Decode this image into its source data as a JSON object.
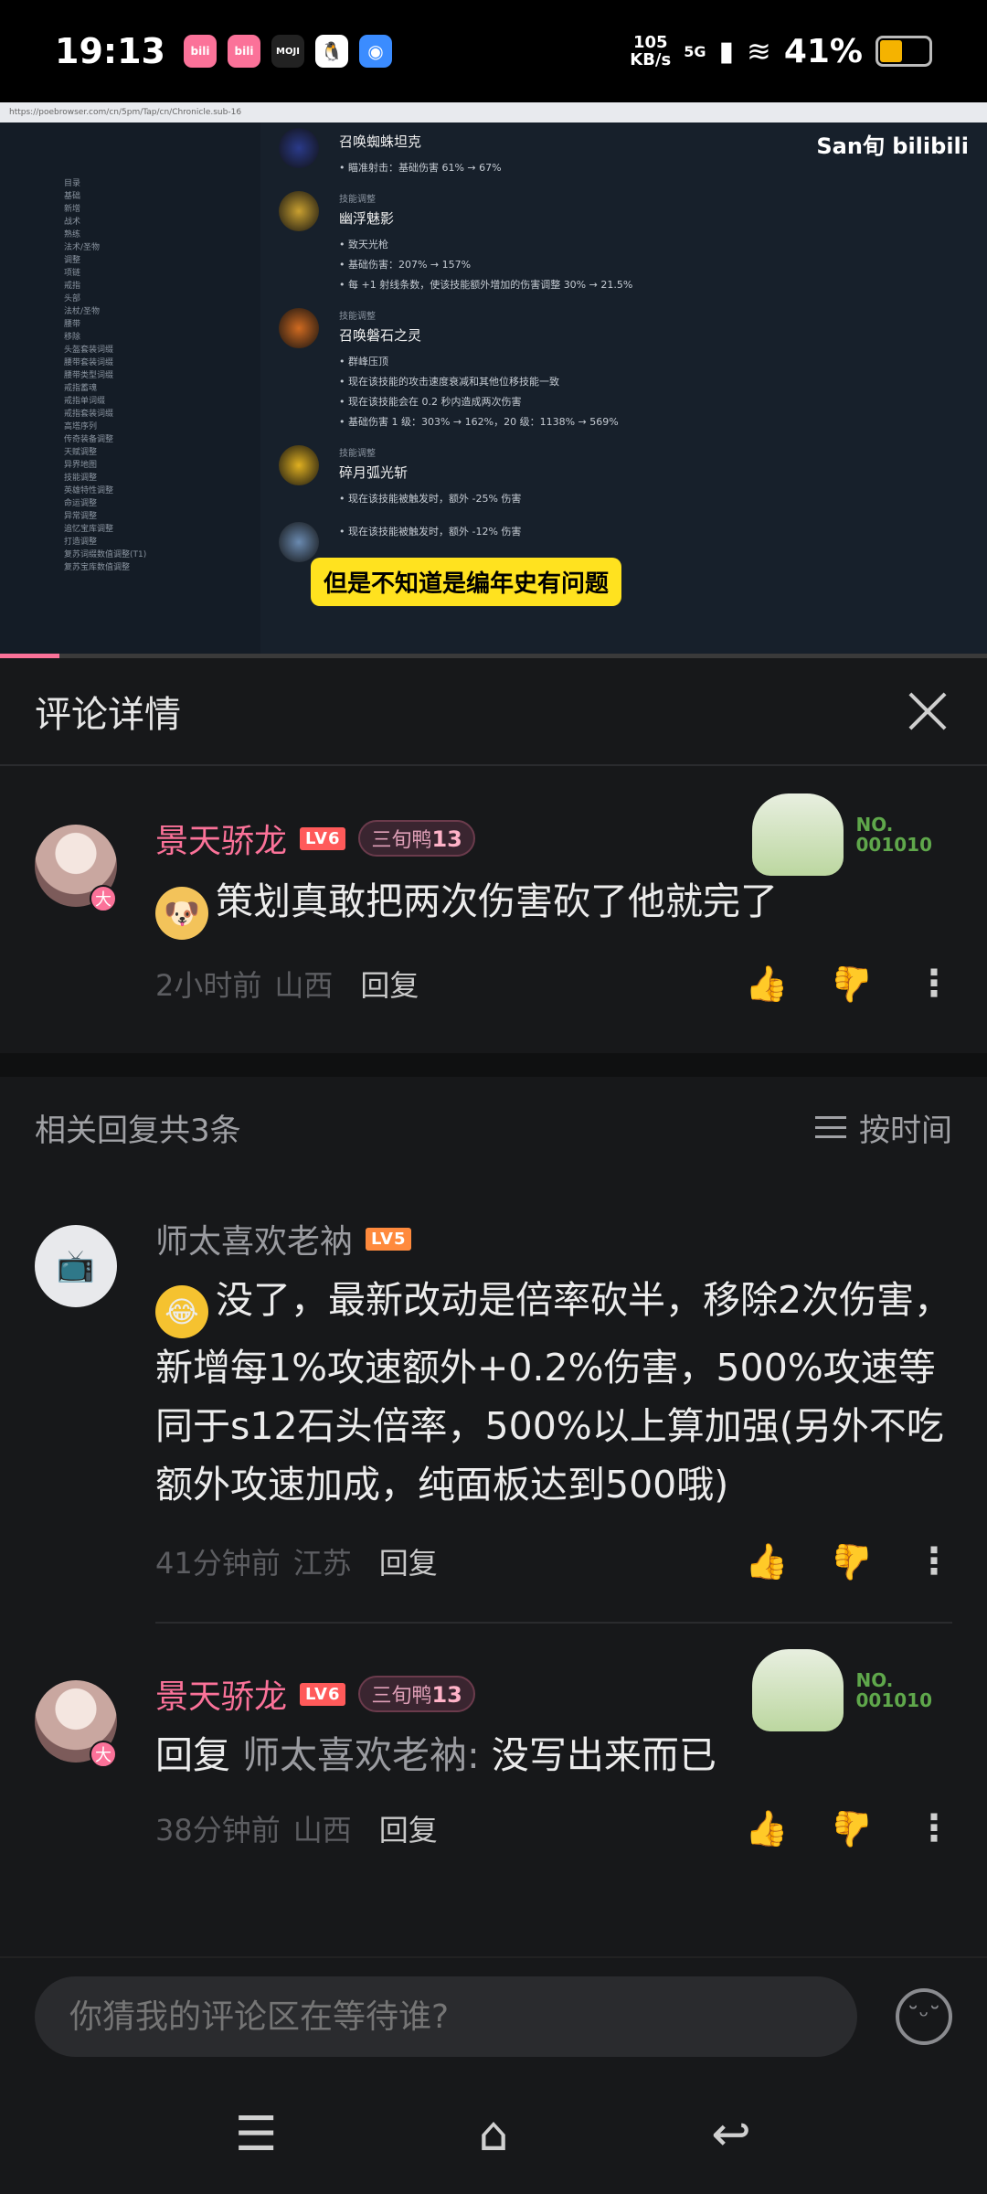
{
  "status_bar": {
    "time": "19:13",
    "net_speed": "105",
    "net_unit": "KB/s",
    "network": "5G",
    "battery": "41%",
    "apps": [
      "bilibili",
      "bilibili",
      "MOJI",
      "QQ",
      "browser"
    ]
  },
  "video": {
    "logo": "San旬 bilibili",
    "caption": "但是不知道是编年史有问题",
    "url": "https://poebrowser.com/cn/5pm/Tap/cn/Chronicle.sub-16",
    "sidebar": [
      "目录",
      "基础",
      "新增",
      "战术",
      "熟练",
      "法术/圣物",
      "调整",
      "项链",
      "戒指",
      "头部",
      "法杖/圣物",
      "腰带",
      "移除",
      "头盔套装词缀",
      "腰带套装词缀",
      "腰带类型词缀",
      "戒指蓄魂",
      "戒指单词缀",
      "戒指套装词缀",
      "高塔序列",
      "传奇装备调整",
      "天赋调整",
      "异界地图",
      "技能调整",
      "英雄特性调整",
      "命运调整",
      "异常调整",
      "追忆宝库调整",
      "打造调整",
      "复苏词缀数值调整(T1)",
      "复苏宝库数值调整"
    ],
    "entries": [
      {
        "tag": "",
        "name": "召唤蜘蛛坦克",
        "lines": [
          "瞄准射击：基础伤害 61% → 67%"
        ]
      },
      {
        "tag": "技能调整",
        "name": "幽浮魅影",
        "lines": [
          "致天光枪",
          "基础伤害：207% → 157%",
          "每 +1 射线条数，使该技能额外增加的伤害调整 30% → 21.5%"
        ]
      },
      {
        "tag": "技能调整",
        "name": "召唤磐石之灵",
        "lines": [
          "群峰压顶",
          "现在该技能的攻击速度衰减和其他位移技能一致",
          "现在该技能会在 0.2 秒内造成两次伤害",
          "基础伤害 1 级：303% → 162%，20 级：1138% → 569%"
        ]
      },
      {
        "tag": "技能调整",
        "name": "碎月弧光斩",
        "lines": [
          "现在该技能被触发时，额外 -25% 伤害"
        ]
      },
      {
        "tag": "",
        "name": "",
        "lines": [
          "现在该技能被触发时，额外 -12% 伤害"
        ]
      }
    ],
    "progress": 0.06
  },
  "panel": {
    "title": "评论详情"
  },
  "main_comment": {
    "username": "景天骄龙",
    "level": "LV6",
    "fan_badge_name": "三旬鸭",
    "fan_badge_level": "13",
    "avatar_badge": "大",
    "deco_no": "NO.",
    "deco_num": "001010",
    "text": "策划真敢把两次伤害砍了他就完了",
    "time": "2小时前",
    "location": "山西",
    "reply_label": "回复"
  },
  "replies_header": {
    "count_text": "相关回复共3条",
    "sort_label": "按时间"
  },
  "replies": [
    {
      "username": "师太喜欢老衲",
      "level": "LV5",
      "text": "没了，最新改动是倍率砍半，移除2次伤害，新增每1%攻速额外+0.2%伤害，500%攻速等同于s12石头倍率，500%以上算加强(另外不吃额外攻速加成，纯面板达到500哦)",
      "time": "41分钟前",
      "location": "江苏",
      "reply_label": "回复"
    },
    {
      "username": "景天骄龙",
      "level": "LV6",
      "fan_badge_name": "三旬鸭",
      "fan_badge_level": "13",
      "avatar_badge": "大",
      "deco_no": "NO.",
      "deco_num": "001010",
      "reply_prefix": "回复",
      "reply_target": "师太喜欢老衲:",
      "text": "没写出来而已",
      "time": "38分钟前",
      "location": "山西",
      "reply_label": "回复"
    }
  ],
  "input": {
    "placeholder": "你猜我的评论区在等待谁?"
  },
  "icons": {
    "like": "thumbs-up-icon",
    "dislike": "thumbs-down-icon",
    "more": "more-vertical-icon",
    "emoji": "emoji-icon",
    "close": "close-icon"
  },
  "colors": {
    "accent_pink": "#fb7299",
    "background": "#17181a",
    "caption_yellow": "#ffe21f"
  }
}
